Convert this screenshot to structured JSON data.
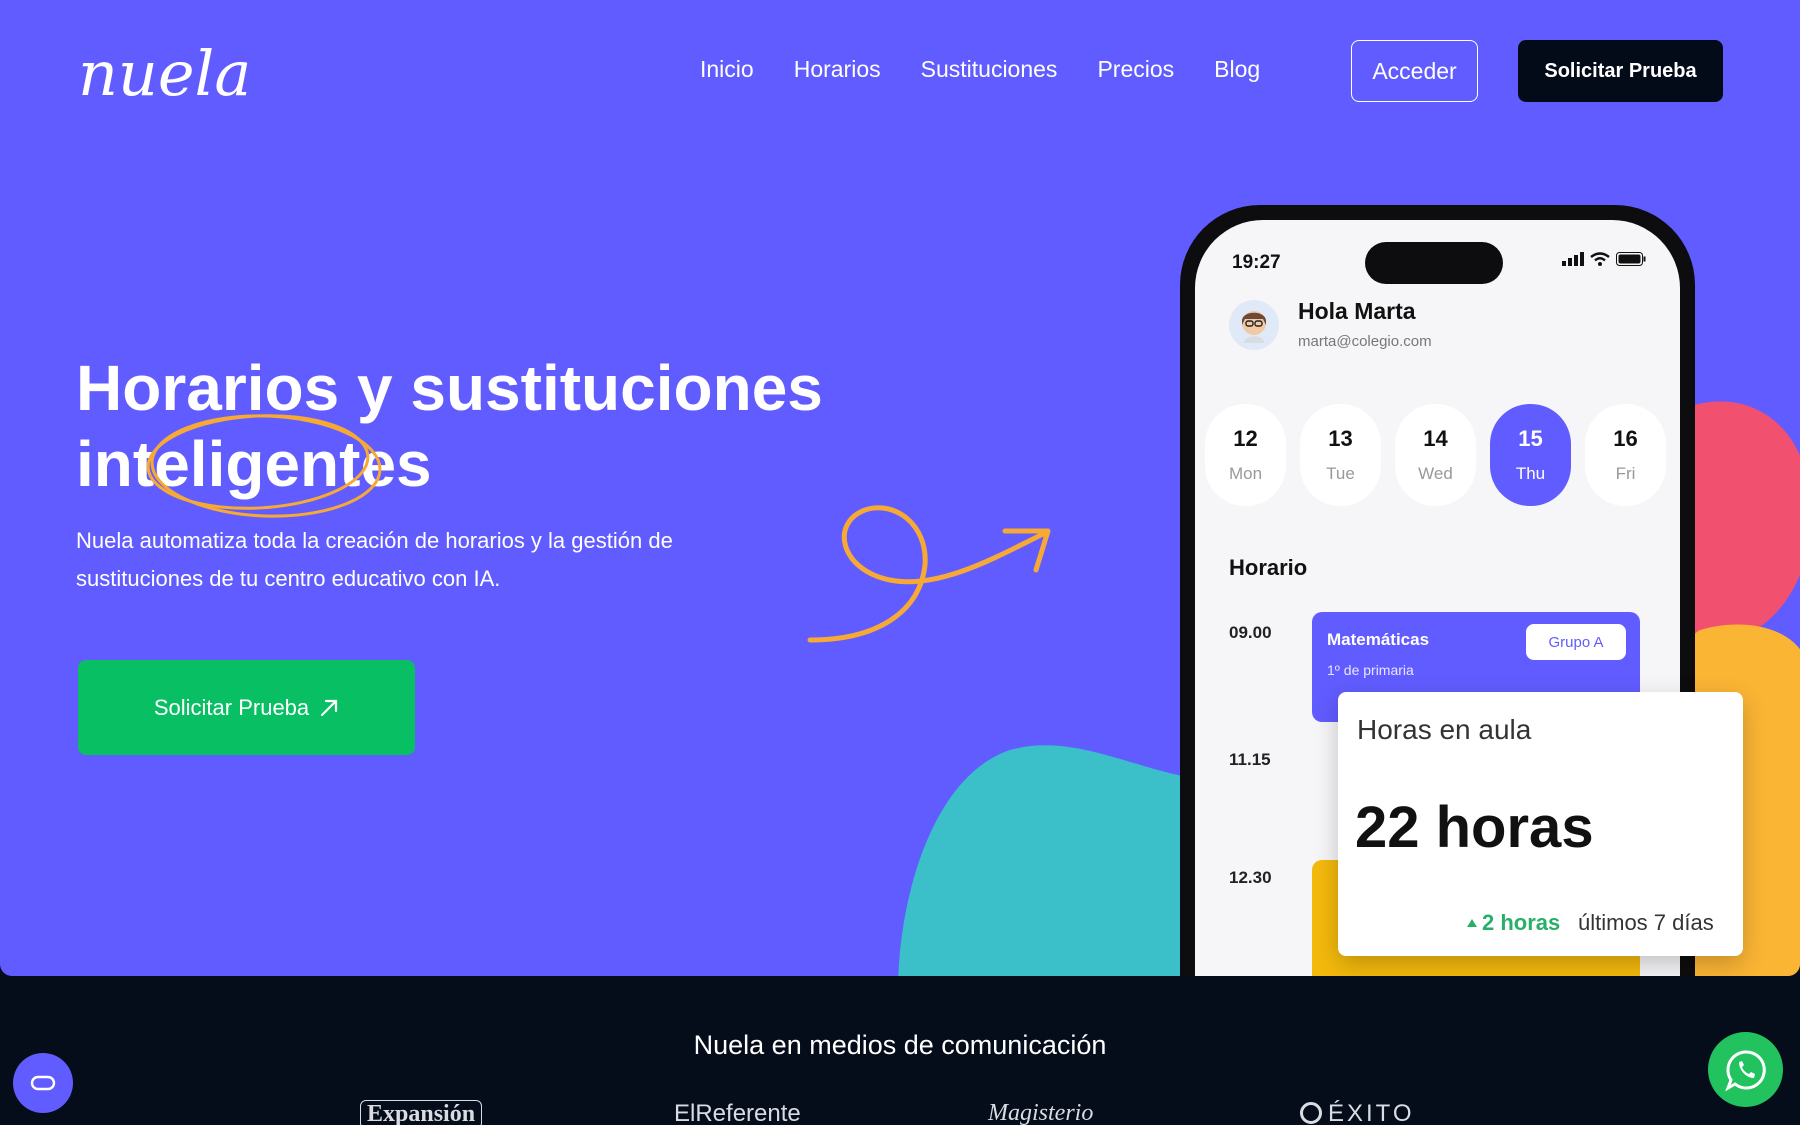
{
  "brand": {
    "logo_text": "nuela",
    "accent": "#615cff",
    "cta_green": "#08c063",
    "dark": "#040b18"
  },
  "nav": {
    "items": [
      "Inicio",
      "Horarios",
      "Sustituciones",
      "Precios",
      "Blog"
    ],
    "access_label": "Acceder",
    "trial_label": "Solicitar Prueba"
  },
  "hero": {
    "headline_line1": "Horarios y sustituciones",
    "headline_line2": "inteligentes",
    "subtext": "Nuela automatiza toda la creación de horarios y la gestión de sustituciones de tu centro educativo con IA.",
    "cta_label": "Solicitar Prueba",
    "cta_icon": "arrow-up-right-icon"
  },
  "phone": {
    "time": "19:27",
    "greeting": "Hola Marta",
    "email": "marta@colegio.com",
    "days": [
      {
        "num": "12",
        "wd": "Mon",
        "active": false
      },
      {
        "num": "13",
        "wd": "Tue",
        "active": false
      },
      {
        "num": "14",
        "wd": "Wed",
        "active": false
      },
      {
        "num": "15",
        "wd": "Thu",
        "active": true
      },
      {
        "num": "16",
        "wd": "Fri",
        "active": false
      }
    ],
    "schedule_title": "Horario",
    "slots": [
      "09.00",
      "11.15",
      "12.30"
    ],
    "class1": {
      "title": "Matemáticas",
      "sub": "1º de primaria",
      "badge": "Grupo A"
    }
  },
  "stat_card": {
    "label": "Horas en aula",
    "value": "22 horas",
    "delta": "2 horas",
    "period": "últimos 7 días"
  },
  "media": {
    "title": "Nuela en medios de comunicación",
    "logos": [
      "Expansión",
      "ElReferente",
      "Magisterio",
      "ÉXITO"
    ]
  },
  "floating": {
    "cookie_icon": "cookie-settings-icon",
    "whatsapp_icon": "whatsapp-icon"
  }
}
